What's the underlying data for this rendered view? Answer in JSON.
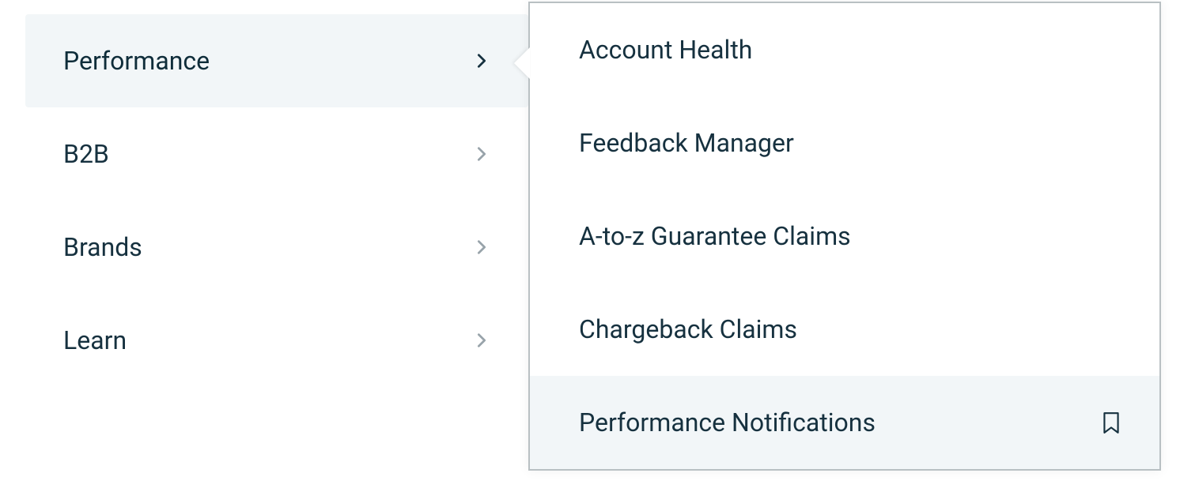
{
  "sidebar": {
    "items": [
      {
        "label": "Performance",
        "active": true
      },
      {
        "label": "B2B",
        "active": false
      },
      {
        "label": "Brands",
        "active": false
      },
      {
        "label": "Learn",
        "active": false
      }
    ]
  },
  "flyout": {
    "items": [
      {
        "label": "Account Health",
        "hovered": false,
        "bookmark": false
      },
      {
        "label": "Feedback Manager",
        "hovered": false,
        "bookmark": false
      },
      {
        "label": "A-to-z Guarantee Claims",
        "hovered": false,
        "bookmark": false
      },
      {
        "label": "Chargeback Claims",
        "hovered": false,
        "bookmark": false
      },
      {
        "label": "Performance Notifications",
        "hovered": true,
        "bookmark": true
      }
    ]
  }
}
